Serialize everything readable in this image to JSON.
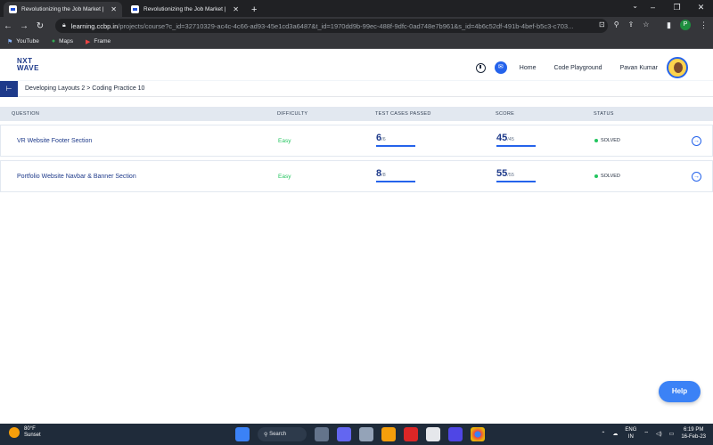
{
  "browser": {
    "tabs": [
      {
        "title": "Revolutionizing the Job Market |",
        "active": true
      },
      {
        "title": "Revolutionizing the Job Market |",
        "active": false
      }
    ],
    "url_host": "learning.ccbp.in",
    "url_path": "/projects/course?c_id=32710329-ac4c-4c66-ad93-45e1cd3a6487&t_id=1970dd9b-99ec-488f-9dfc-0ad748e7b961&s_id=4b6c52df-491b-4bef-b5c3-c703...",
    "profile_initial": "P",
    "bookmarks": [
      "YouTube",
      "Maps",
      "Frame"
    ]
  },
  "header": {
    "logo_line1": "NXT",
    "logo_line2": "WAVE",
    "nav": [
      "Home",
      "Code Playground"
    ],
    "user_name": "Pavan Kumar"
  },
  "breadcrumb": "Developing Layouts 2 > Coding Practice 10",
  "table": {
    "headers": [
      "QUESTION",
      "DIFFICULTY",
      "TEST CASES PASSED",
      "SCORE",
      "STATUS"
    ],
    "rows": [
      {
        "question": "VR Website Footer Section",
        "difficulty": "Easy",
        "tests_passed": "6",
        "tests_total": "/6",
        "score": "45",
        "score_total": "/45",
        "status": "SOLVED"
      },
      {
        "question": "Portfolio Website Navbar & Banner Section",
        "difficulty": "Easy",
        "tests_passed": "8",
        "tests_total": "/8",
        "score": "55",
        "score_total": "/55",
        "status": "SOLVED"
      }
    ]
  },
  "help_label": "Help",
  "taskbar": {
    "weather_temp": "80°F",
    "weather_desc": "Sunset",
    "search_label": "Search",
    "lang_line1": "ENG",
    "lang_line2": "IN",
    "time": "6:19 PM",
    "date": "16-Feb-23"
  },
  "colors": {
    "accent": "#2563eb",
    "brand": "#1e3a8a",
    "success": "#22c55e"
  }
}
